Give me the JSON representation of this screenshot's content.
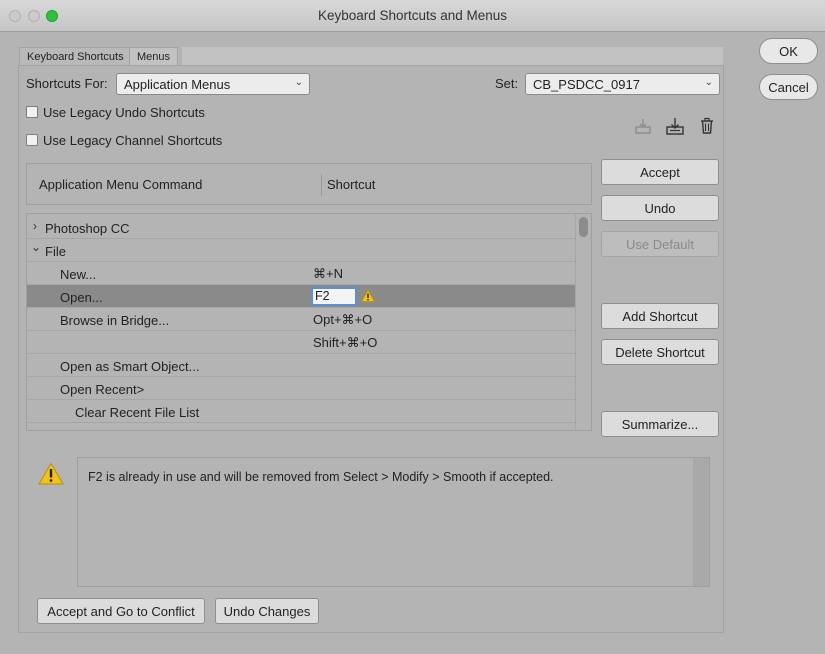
{
  "window": {
    "title": "Keyboard Shortcuts and Menus"
  },
  "tabs": [
    {
      "label": "Keyboard Shortcuts"
    },
    {
      "label": "Menus"
    }
  ],
  "shortcuts_for": {
    "label": "Shortcuts For:",
    "value": "Application Menus"
  },
  "set": {
    "label": "Set:",
    "value": "CB_PSDCC_0917"
  },
  "options": {
    "legacy_undo": {
      "label": "Use Legacy Undo Shortcuts",
      "checked": false
    },
    "legacy_channel": {
      "label": "Use Legacy Channel Shortcuts",
      "checked": false
    }
  },
  "toolbar_icons": [
    "save-set-icon",
    "save-set-as-icon",
    "delete-set-icon"
  ],
  "table": {
    "columns": [
      "Application Menu Command",
      "Shortcut"
    ],
    "rows": [
      {
        "command": "Photoshop CC",
        "shortcut": "",
        "disclosure": "›"
      },
      {
        "command": "File",
        "shortcut": "",
        "disclosure": "⌄"
      },
      {
        "command": "New...",
        "shortcut": "⌘+N"
      },
      {
        "command": "Open...",
        "shortcut": "F2",
        "selected": true,
        "warning": true
      },
      {
        "command": "Browse in Bridge...",
        "shortcut": "Opt+⌘+O"
      },
      {
        "command": "",
        "shortcut": "Shift+⌘+O"
      },
      {
        "command": "Open as Smart Object...",
        "shortcut": ""
      },
      {
        "command": "Open Recent>",
        "shortcut": ""
      },
      {
        "command": "Clear Recent File List",
        "shortcut": ""
      }
    ]
  },
  "side_buttons": {
    "accept": "Accept",
    "undo": "Undo",
    "use_default": "Use Default",
    "add_shortcut": "Add Shortcut",
    "delete_shortcut": "Delete Shortcut",
    "summarize": "Summarize..."
  },
  "dialog_buttons": {
    "ok": "OK",
    "cancel": "Cancel"
  },
  "message": "F2 is already in use and will be removed from Select > Modify > Smooth if accepted.",
  "bottom_buttons": {
    "accept_conflict": "Accept and Go to Conflict",
    "undo_changes": "Undo Changes"
  },
  "colors": {
    "warning": "#f2c21b",
    "selection": "#8a8a8a",
    "focus_ring": "#5b8fd6"
  }
}
